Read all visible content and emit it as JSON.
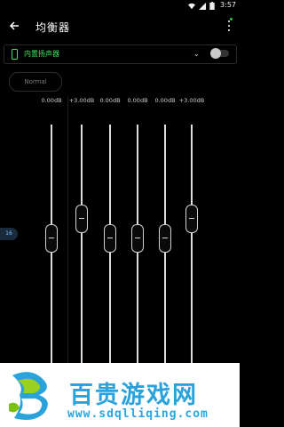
{
  "status": {
    "time": "3:57"
  },
  "appbar": {
    "title": "均衡器",
    "back_icon": "arrow-left-icon",
    "more_icon": "more-vert-icon"
  },
  "device": {
    "label": "内置扬声器",
    "enabled": false
  },
  "preset": {
    "label": "Normal"
  },
  "position_indicator": "16",
  "bands": [
    {
      "gain_label": "0.00dB",
      "gain_db": 0.0
    },
    {
      "gain_label": "+3.00dB",
      "gain_db": 3.0
    },
    {
      "gain_label": "0.00dB",
      "gain_db": 0.0
    },
    {
      "gain_label": "0.00dB",
      "gain_db": 0.0
    },
    {
      "gain_label": "0.00dB",
      "gain_db": 0.0
    },
    {
      "gain_label": "+3.00dB",
      "gain_db": 3.0
    }
  ],
  "watermark": {
    "title": "百贵游戏网",
    "url": "www.sdqlliqing.com"
  },
  "colors": {
    "accent_green": "#40e060",
    "watermark_blue": "#2aa2dc"
  }
}
